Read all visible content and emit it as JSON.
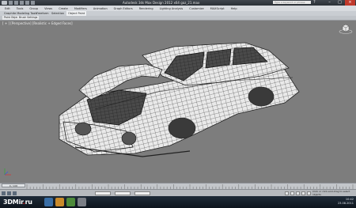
{
  "titlebar": {
    "title": "Autodesk 3ds Max Design 2012 x64   gaz_21.max",
    "search_placeholder": "Type a keyword or phrase",
    "help_icon": "question-icon"
  },
  "menubar": {
    "items": [
      "Edit",
      "Tools",
      "Group",
      "Views",
      "Create",
      "Modifiers",
      "Animation",
      "Graph Editors",
      "Rendering",
      "Lighting Analysis",
      "Customize",
      "MAXScript",
      "Help"
    ]
  },
  "ribbon": {
    "tabs": [
      "Graphite Modeling Tools",
      "Freeform",
      "Selection",
      "Object Paint"
    ],
    "active_tab": "Object Paint",
    "subtabs": [
      "Paint Objects",
      "Brush Settings"
    ]
  },
  "viewport": {
    "label": "[ + ] [Perspective] [Realistic + Edged Faces]",
    "background": "#7d7d7d"
  },
  "timeline": {
    "slider_label": "0 / 100",
    "ticks": [
      "0",
      "5",
      "10",
      "15",
      "20",
      "25",
      "30",
      "35",
      "40",
      "45",
      "50",
      "55",
      "60",
      "65",
      "70",
      "75",
      "80",
      "85",
      "90",
      "95",
      "100"
    ]
  },
  "statusbar": {
    "prompt": "Click or click-and-drag to select objects"
  },
  "taskbar": {
    "time": "10:42",
    "date": "23.08.2011"
  },
  "watermark": {
    "text_main": "3DMir",
    "text_dot": ".",
    "text_tld": "ru"
  },
  "colors": {
    "accent": "#e02020",
    "viewport_bg": "#7d7d7d",
    "mesh_fill": "#ebebeb",
    "wire": "#2a2a2a"
  }
}
